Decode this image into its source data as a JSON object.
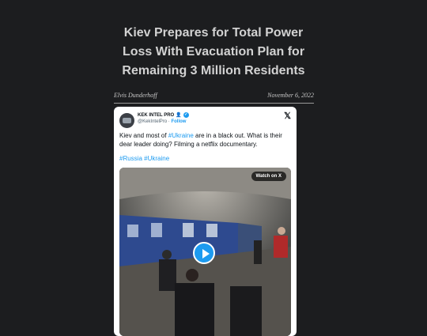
{
  "article": {
    "headline": "Kiev Prepares for Total Power Loss With Evacuation Plan for Remaining 3 Million Residents",
    "author": "Elvis Dunderhoff",
    "date": "November 6, 2022"
  },
  "tweet": {
    "display_name": "KEK INTEL PRO",
    "name_emoji": "👤",
    "handle": "@KekIntelPro",
    "separator": "·",
    "follow_label": "Follow",
    "text_before": "Kiev and most of ",
    "text_tag": "#Ukraine",
    "text_after": " are in a black out. What is their dear leader doing? Filming a netflix documentary.",
    "hashtags": "#Russia #Ukraine",
    "watch_label": "Watch on X",
    "x_logo": "𝕏"
  },
  "icons": {
    "verified": "verified-badge-icon",
    "close": "x-logo-icon",
    "play": "play-icon"
  },
  "colors": {
    "page_bg": "#1c1d1f",
    "link": "#1d9bf0"
  }
}
